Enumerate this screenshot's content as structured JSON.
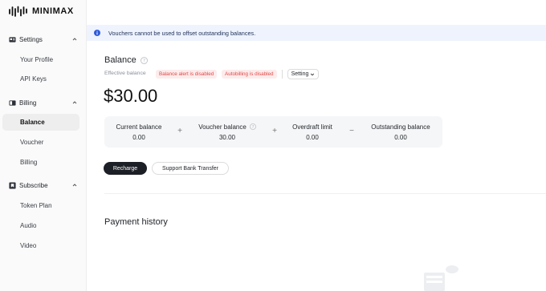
{
  "brand": {
    "name": "MINIMAX"
  },
  "sidebar": {
    "sections": [
      {
        "label": "Settings",
        "icon": "id-card-icon",
        "items": [
          {
            "label": "Your Profile"
          },
          {
            "label": "API Keys"
          }
        ]
      },
      {
        "label": "Billing",
        "icon": "wallet-icon",
        "items": [
          {
            "label": "Balance",
            "active": true
          },
          {
            "label": "Voucher"
          },
          {
            "label": "Billing"
          }
        ]
      },
      {
        "label": "Subscribe",
        "icon": "bookmark-icon",
        "items": [
          {
            "label": "Token Plan"
          },
          {
            "label": "Audio"
          },
          {
            "label": "Video"
          }
        ]
      }
    ]
  },
  "notice": {
    "text": "Vouchers cannot be used to offset outstanding balances."
  },
  "balance": {
    "title": "Balance",
    "effective_label": "Effective balance",
    "tags": [
      "Balance alert is disabled",
      "Autobilling is disabled"
    ],
    "setting_label": "Setting",
    "amount": "$30.00",
    "summary": [
      {
        "label": "Current balance",
        "value": "0.00"
      },
      {
        "label": "Voucher balance",
        "value": "30.00"
      },
      {
        "label": "Overdraft limit",
        "value": "0.00"
      },
      {
        "label": "Outstanding balance",
        "value": "0.00"
      }
    ],
    "operators": [
      "+",
      "+",
      "−"
    ]
  },
  "actions": {
    "recharge": "Recharge",
    "transfer": "Support Bank Transfer"
  },
  "payment_history": {
    "title": "Payment history"
  },
  "colors": {
    "accent_dark": "#1c1f26",
    "tag_bg": "#fdecec",
    "tag_text": "#e04848",
    "notice_bg": "#eef3fd",
    "info_blue": "#2f5bd8"
  }
}
